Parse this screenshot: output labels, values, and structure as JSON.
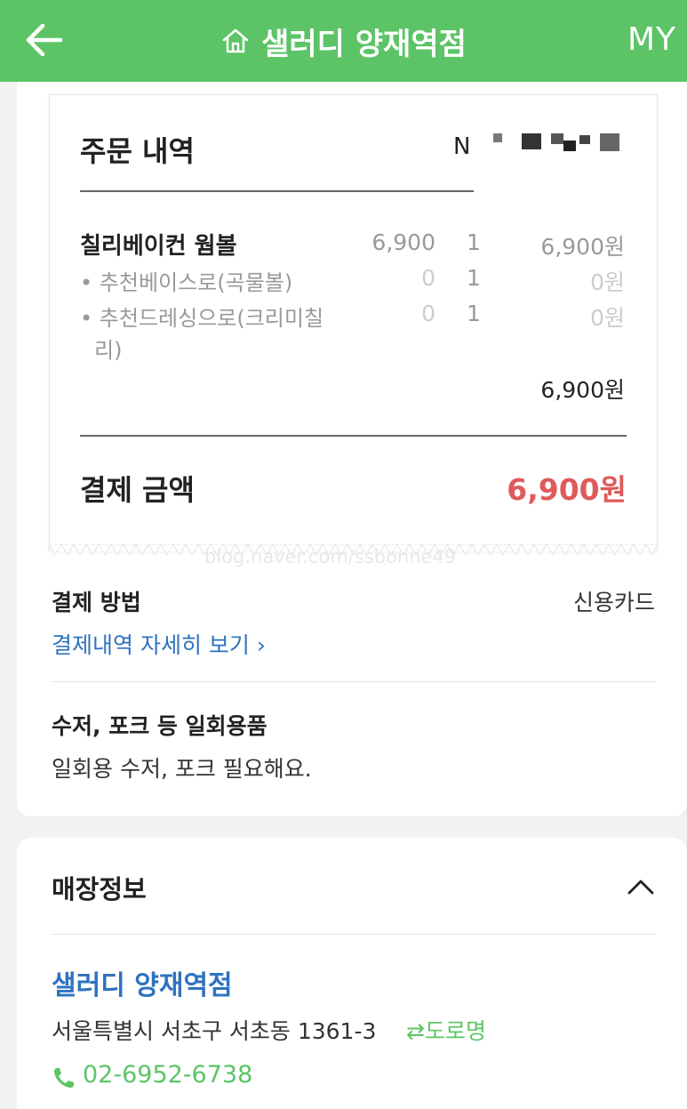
{
  "header": {
    "title": "샐러디 양재역점",
    "my_label": "MY",
    "background": "#5cc466"
  },
  "receipt": {
    "title": "주문 내역",
    "order_no_prefix": "N",
    "item": {
      "name": "칠리베이컨 웜볼",
      "price": "6,900",
      "qty": "1",
      "total": "6,900원"
    },
    "options": [
      {
        "name": "• 추천베이스로(곡물볼)",
        "price": "0",
        "qty": "1",
        "total": "0원"
      },
      {
        "name_line1": "• 추천드레싱으로(크리미칠",
        "name_line2": "리)",
        "price": "0",
        "qty": "1",
        "total": "0원"
      }
    ],
    "subtotal": "6,900원",
    "pay_label": "결제 금액",
    "pay_amount": "6,900원",
    "watermark": "blog.naver.com/ssbonne49"
  },
  "payment": {
    "method_label": "결제 방법",
    "method_value": "신용카드",
    "detail_link": "결제내역 자세히 보기 ›"
  },
  "utensils": {
    "label": "수저, 포크 등 일회용품",
    "value": "일회용 수저, 포크 필요해요."
  },
  "store": {
    "section_title": "매장정보",
    "name": "샐러디 양재역점",
    "address": "서울특별시 서초구 서초동 1361-3",
    "road_toggle": "⇄도로명",
    "phone": "02-6952-6738"
  },
  "colors": {
    "accent_green": "#5cc466",
    "link_blue": "#2f72c0",
    "amount_red": "#e05a5a"
  },
  "icons": [
    "back-arrow-icon",
    "home-icon",
    "chevron-up-icon",
    "phone-icon"
  ]
}
